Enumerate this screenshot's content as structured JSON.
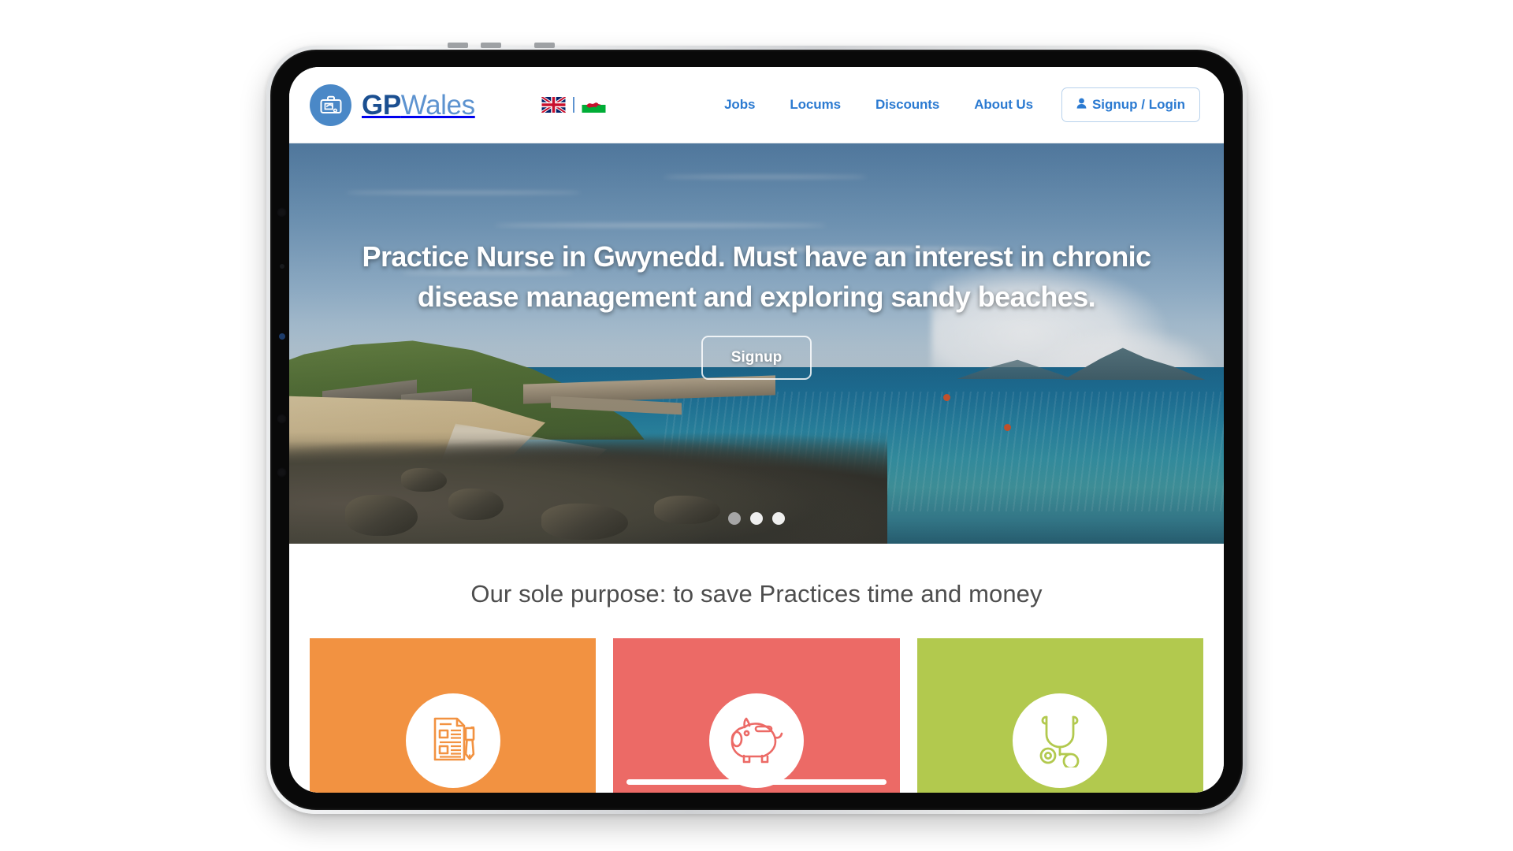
{
  "device": {
    "type": "tablet",
    "orientation": "landscape"
  },
  "site": {
    "brand": {
      "icon": "medical-briefcase-icon",
      "name_bold": "GP",
      "name_light": "Wales",
      "mark_color": "#4a88c7",
      "bold_color": "#1b4f91",
      "light_color": "#5d93d0"
    },
    "language": {
      "flags": [
        {
          "name": "union-jack-flag",
          "label": "English"
        },
        {
          "name": "welsh-flag",
          "label": "Cymraeg"
        }
      ],
      "separator": "|"
    },
    "nav": {
      "links": [
        {
          "label": "Jobs"
        },
        {
          "label": "Locums"
        },
        {
          "label": "Discounts"
        },
        {
          "label": "About Us"
        }
      ],
      "account_button": {
        "label": "Signup / Login",
        "icon": "user-icon",
        "color": "#2b7ad1",
        "border_color": "#b8d2ec"
      }
    }
  },
  "hero": {
    "headline": "Practice Nurse in Gwynedd. Must have an interest in chronic disease management and exploring sandy beaches.",
    "cta_label": "Signup",
    "background_alt": "Coastal bay in Gwynedd with sandy beach, stone harbour buildings and turquoise sea",
    "carousel": {
      "total_slides": 3,
      "active_index": 0
    }
  },
  "purpose": {
    "title": "Our sole purpose: to save Practices time and money"
  },
  "cards": [
    {
      "name": "paperwork-card",
      "color": "#F29241",
      "icon": "document-and-pen-icon"
    },
    {
      "name": "savings-card",
      "color": "#EC6A66",
      "icon": "piggy-bank-icon"
    },
    {
      "name": "clinical-card",
      "color": "#B2C94E",
      "icon": "stethoscope-icon"
    }
  ]
}
